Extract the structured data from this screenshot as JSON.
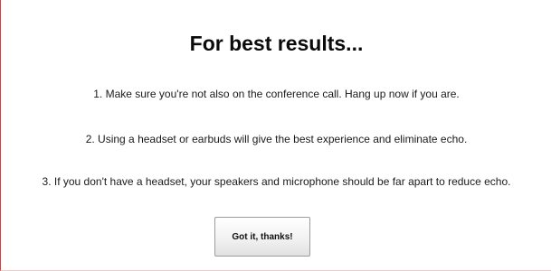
{
  "dialog": {
    "title": "For best results...",
    "items": [
      "1. Make sure you're not also on the conference call.  Hang up now if you are.",
      "2. Using a headset or earbuds will give the best experience and eliminate echo.",
      "3. If you don't have a headset, your speakers and microphone should be far apart to reduce echo."
    ],
    "button_label": "Got it, thanks!"
  },
  "colors": {
    "accent_border": "#e23a3a",
    "text": "#111111",
    "button_border": "#9c9c9c"
  }
}
